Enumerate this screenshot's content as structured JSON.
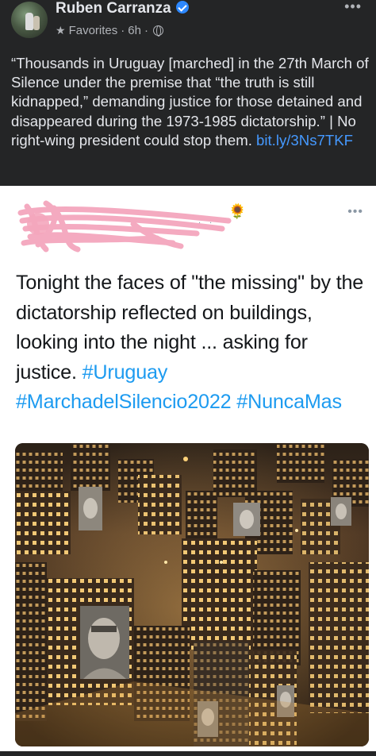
{
  "post": {
    "author": "Ruben Carranza",
    "audience": "Favorites",
    "time": "6h",
    "text": "“Thousands in Uruguay [marched] in the 27th March of Silence under the premise that “the truth is still kidnapped,” demanding justice for those detained and disappeared during the 1973-1985 dictatorship.” | No right-wing president could stop them. ",
    "link": "bit.ly/3Ns7TKF"
  },
  "tweet": {
    "text": "Tonight the faces of \"the missing\" by the dictatorship reflected on buildings, looking into the night ... asking for justice. ",
    "hashtags": [
      "#Uruguay",
      "#MarchadelSilencio2022",
      "#NuncaMas"
    ]
  },
  "colors": {
    "fb_background": "#242526",
    "link": "#4599ff",
    "hashtag": "#1d9bf0",
    "redaction": "#f4a6bd"
  },
  "icons": {
    "verified": "verified-badge-icon",
    "audience": "star-icon",
    "privacy": "globe-icon",
    "more": "more-options-icon",
    "sunflower": "sunflower-emoji-icon"
  }
}
